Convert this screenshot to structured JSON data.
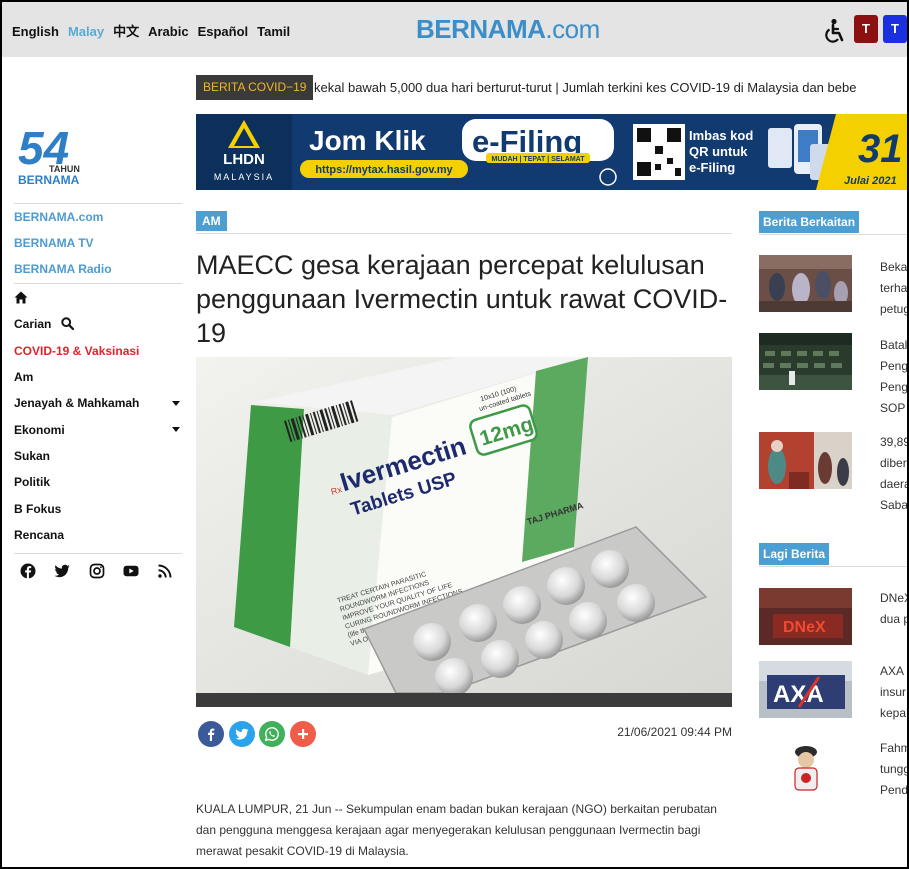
{
  "topbar": {
    "languages": [
      "English",
      "Malay",
      "中文",
      "Arabic",
      "Español",
      "Tamil"
    ],
    "active_language": "Malay",
    "brand_main": "BERNAMA",
    "brand_suffix": ".com",
    "accessibility_icon": "wheelchair-icon",
    "text_size_buttons": [
      "T",
      "T"
    ]
  },
  "sidebar": {
    "logo_number": "54",
    "logo_tahun": "TAHUN",
    "logo_name": "BERNAMA",
    "links": [
      "BERNAMA.com",
      "BERNAMA TV",
      "BERNAMA Radio"
    ],
    "home_icon": "home-icon",
    "nav": [
      "Carian",
      "COVID-19 & Vaksinasi",
      "Am",
      "Jenayah & Mahkamah",
      "Ekonomi",
      "Sukan",
      "Politik",
      "B Fokus",
      "Rencana"
    ],
    "social_icons": [
      "facebook-icon",
      "twitter-icon",
      "instagram-icon",
      "youtube-icon",
      "rss-icon"
    ]
  },
  "ticker": {
    "label": "BERITA COVID−19",
    "text": "kekal bawah 5,000 dua hari berturut-turut | Jumlah terkini kes COVID-19 di Malaysia dan bebe"
  },
  "banner": {
    "lhdn": "LHDN",
    "malaysia": "MALAYSIA",
    "jom_klik": "Jom Klik",
    "efiling": "e-Filing",
    "url": "https://mytax.hasil.gov.my",
    "tagline": "MUDAH | TEPAT | SELAMAT",
    "imbas": "Imbas kod",
    "qr_untuk": "QR untuk",
    "efiling_small": "e-Filing",
    "day": "31",
    "month": "Julai 2021"
  },
  "article": {
    "category": "AM",
    "headline": "MAECC gesa kerajaan percepat kelulusan penggunaan Ivermectin untuk rawat COVID-19",
    "date": "21/06/2021 09:44 PM",
    "body": "KUALA LUMPUR, 21 Jun  -- Sekumpulan enam badan bukan kerajaan (NGO) berkaitan perubatan dan pengguna menggesa kerajaan agar menyegerakan kelulusan penggunaan Ivermectin bagi merawat pesakit COVID-19 di Malaysia.",
    "share_icons": [
      "facebook-icon",
      "twitter-icon",
      "whatsapp-icon",
      "plus-icon"
    ],
    "photo": {
      "brand": "Ivermectin",
      "product": "Tablets USP",
      "dose": "12mg",
      "rx": "Rx",
      "count": "10x10 (100)",
      "coating": "un-coated tablets",
      "maker": "TAJ PHARMA",
      "indications": [
        "TREAT CERTAIN PARASITIC",
        "ROUNDWORM INFECTIONS",
        "IMPROVE YOUR QUALITY OF LIFE",
        "CURING ROUNDWORM INFECTIONS",
        "(life threatening infection)",
        "VIA ORAL"
      ]
    }
  },
  "berkaitan": {
    "title": "Berita Berkaitan",
    "items": [
      [
        "Beka",
        "terha",
        "petug"
      ],
      [
        "Batal",
        "Peng",
        "Peng",
        "SOP"
      ],
      [
        "39,89",
        "diber",
        "daera",
        "Saba"
      ]
    ]
  },
  "lagi": {
    "title": "Lagi Berita",
    "items": [
      [
        "DNeX",
        "dua p"
      ],
      [
        "AXA",
        "insur",
        "kepa"
      ],
      [
        "Fahm",
        "tungg",
        "Pend"
      ]
    ],
    "dnex_logo": "DNeX",
    "axa_logo": "AXA"
  },
  "colors": {
    "accent": "#4b9fd3",
    "brand": "#3c8ec9",
    "covid_red": "#e2232a",
    "banner_navy": "#113a70",
    "banner_yellow": "#f5d000"
  }
}
